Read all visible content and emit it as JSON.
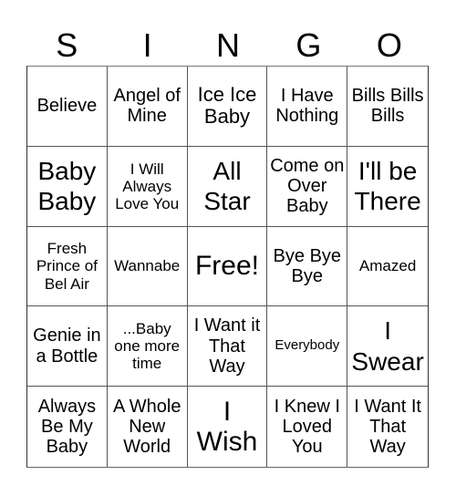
{
  "header": [
    "S",
    "I",
    "N",
    "G",
    "O"
  ],
  "cells": [
    {
      "text": "Believe",
      "size": "fs-l"
    },
    {
      "text": "Angel of Mine",
      "size": "fs-l"
    },
    {
      "text": "Ice Ice Baby",
      "size": "fs-xl"
    },
    {
      "text": "I Have Nothing",
      "size": "fs-l"
    },
    {
      "text": "Bills Bills Bills",
      "size": "fs-l"
    },
    {
      "text": "Baby Baby",
      "size": "fs-xxl"
    },
    {
      "text": "I Will Always Love You",
      "size": "fs-m"
    },
    {
      "text": "All Star",
      "size": "fs-xxl"
    },
    {
      "text": "Come on Over Baby",
      "size": "fs-l"
    },
    {
      "text": "I'll be There",
      "size": "fs-xxl"
    },
    {
      "text": "Fresh Prince of Bel Air",
      "size": "fs-m"
    },
    {
      "text": "Wannabe",
      "size": "fs-m"
    },
    {
      "text": "Free!",
      "size": "fs-free"
    },
    {
      "text": "Bye Bye Bye",
      "size": "fs-l"
    },
    {
      "text": "Amazed",
      "size": "fs-m"
    },
    {
      "text": "Genie in a Bottle",
      "size": "fs-l"
    },
    {
      "text": "...Baby one more time",
      "size": "fs-m"
    },
    {
      "text": "I Want it That Way",
      "size": "fs-l"
    },
    {
      "text": "Everybody",
      "size": "fs-s"
    },
    {
      "text": "I Swear",
      "size": "fs-xxl"
    },
    {
      "text": "Always Be My Baby",
      "size": "fs-l"
    },
    {
      "text": "A Whole New World",
      "size": "fs-l"
    },
    {
      "text": "I Wish",
      "size": "fs-free"
    },
    {
      "text": "I Knew I Loved You",
      "size": "fs-l"
    },
    {
      "text": "I Want It That Way",
      "size": "fs-l"
    }
  ]
}
